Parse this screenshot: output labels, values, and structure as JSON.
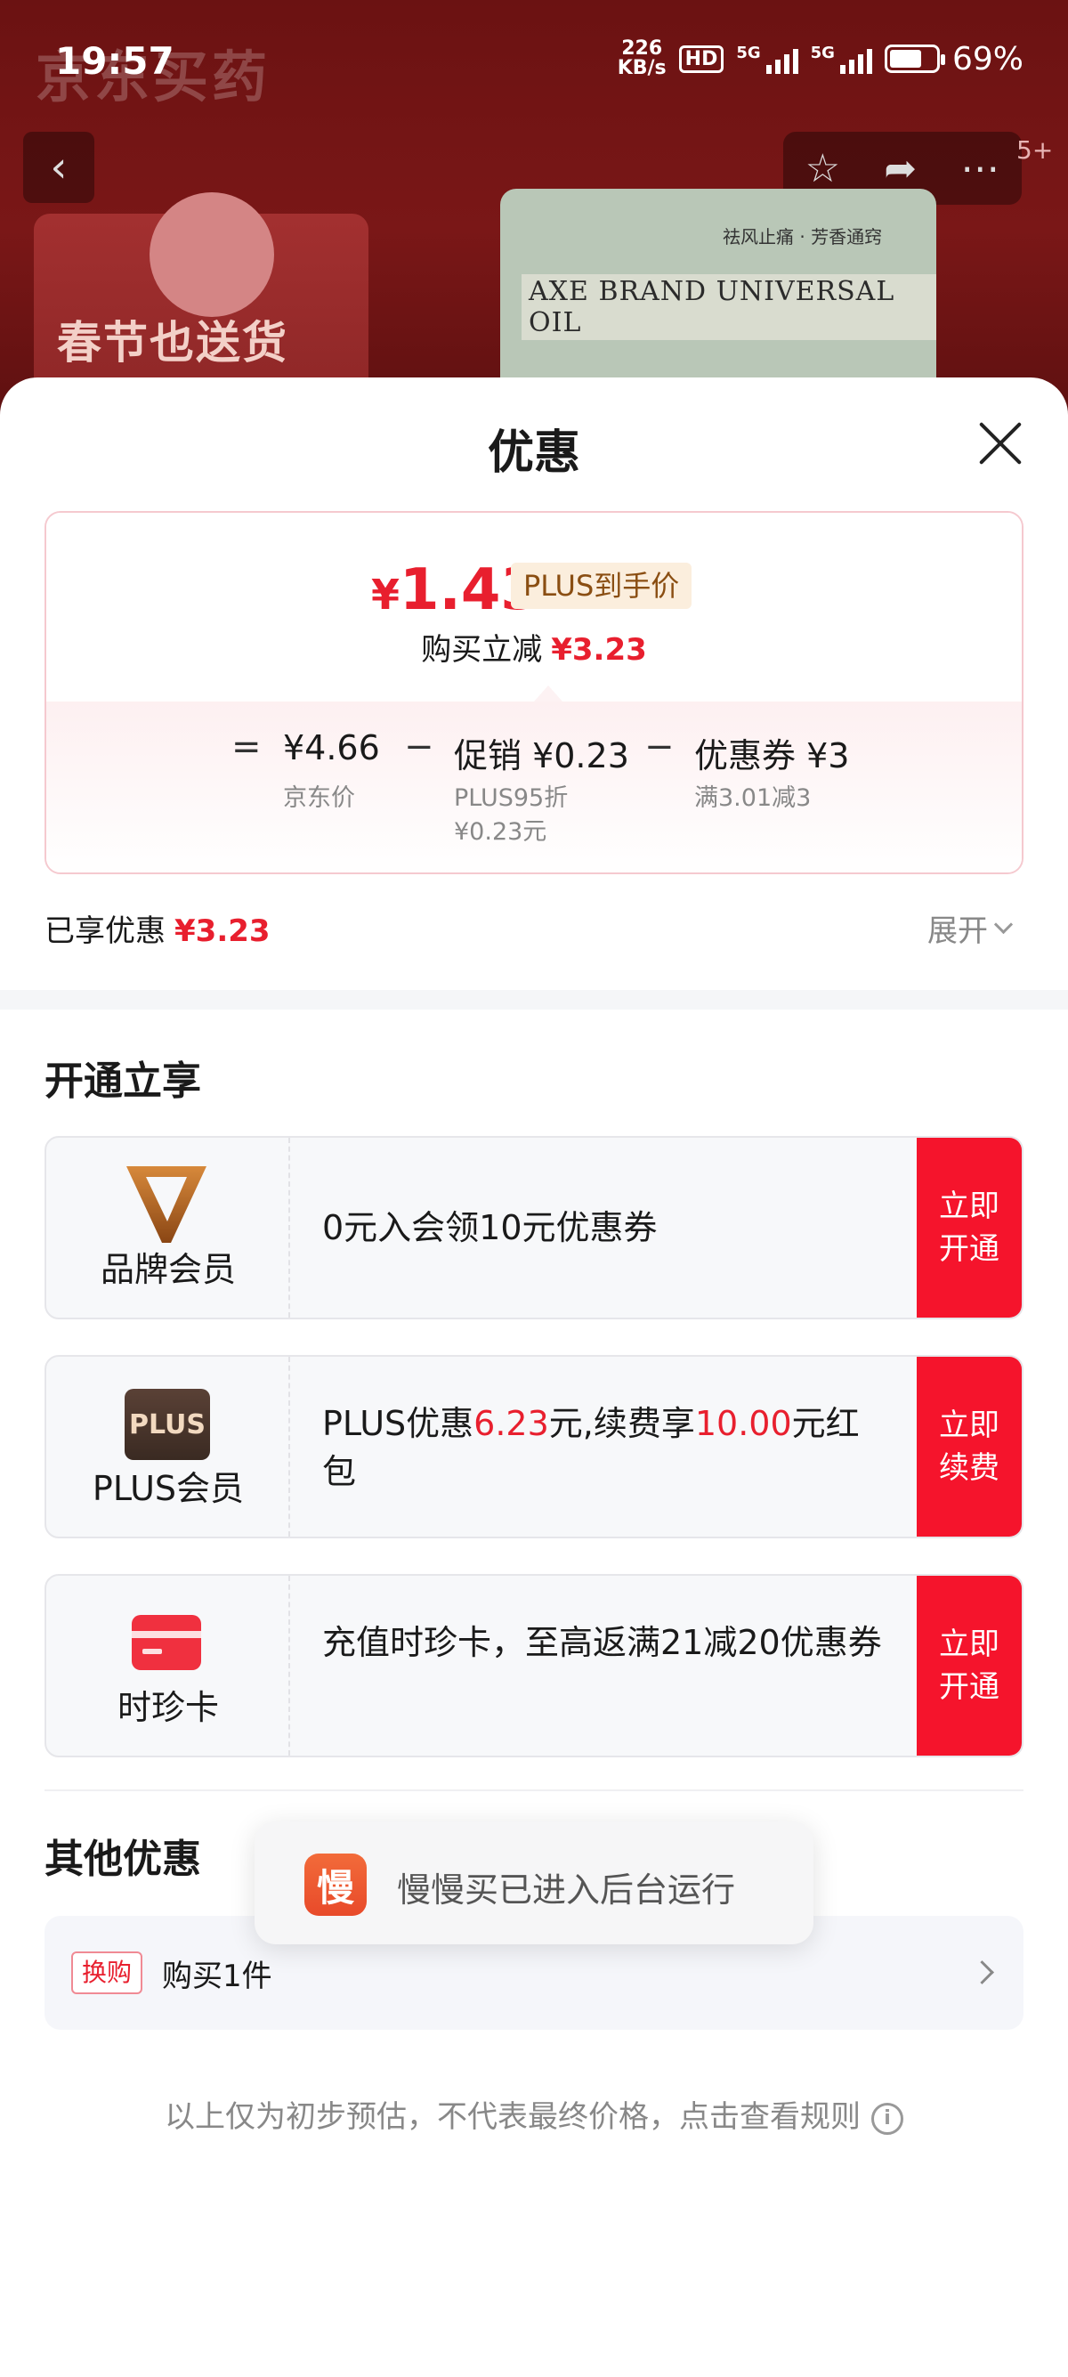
{
  "status_bar": {
    "time": "19:57",
    "net_speed_value": "226",
    "net_speed_unit": "KB/s",
    "hd_label": "HD",
    "sim1_label": "5G",
    "sim2_label": "5G",
    "battery_percent": "69",
    "battery_level": 0.69
  },
  "background": {
    "app_watermark": "京东买药",
    "badge_count": "5+",
    "promo_text": "春节也送货",
    "product_subtitle": "祛风止痛 · 芳香通窍",
    "product_name": "AXE BRAND UNIVERSAL OIL"
  },
  "sheet": {
    "title": "优惠",
    "price": {
      "currency": "¥",
      "final_price": "1.43",
      "plus_tag": "PLUS到手价",
      "reduce_label": "购买立减",
      "reduce_amount": "¥3.23"
    },
    "formula": {
      "equals": "=",
      "base_price": "¥4.66",
      "base_price_label": "京东价",
      "minus1": "−",
      "promo": "促销 ¥0.23",
      "promo_sub1": "PLUS95折",
      "promo_sub2": "¥0.23元",
      "minus2": "−",
      "coupon": "优惠券 ¥3",
      "coupon_sub": "满3.01减3"
    },
    "enjoyed_label": "已享优惠",
    "enjoyed_amount": "¥3.23",
    "expand_label": "展开",
    "open_section_title": "开通立享",
    "members": [
      {
        "label": "品牌会员",
        "desc": "0元入会领10元优惠券",
        "button": "立即开通"
      },
      {
        "label": "PLUS会员",
        "icon_text": "PLUS",
        "desc_part1": "PLUS优惠",
        "desc_red1": "6.23",
        "desc_part2": "元,续费享",
        "desc_red2": "10.00",
        "desc_part3": "元红包",
        "button": "立即续费"
      },
      {
        "label": "时珍卡",
        "desc": "充值时珍卡，至高返满21减20优惠券",
        "button": "立即开通"
      }
    ],
    "other_section_title": "其他优惠",
    "other": {
      "tag": "换购",
      "text": "购买1件"
    },
    "footnote": "以上仅为初步预估，不代表最终价格，点击查看规则",
    "info_icon_glyph": "i"
  },
  "toast": {
    "icon_text": "慢",
    "text": "慢慢买已进入后台运行"
  },
  "colors": {
    "accent_red": "#e81f2e",
    "button_red": "#f5142c",
    "plus_tag_bg": "#fbeedd"
  }
}
